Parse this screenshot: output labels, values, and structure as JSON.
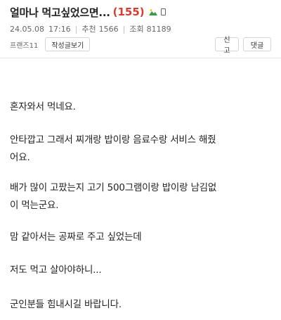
{
  "post": {
    "title": "얼마나 먹고싶었으면...",
    "comment_count": "(155)",
    "has_image_icon": "image-icon",
    "has_mobile_icon": "mobile-icon",
    "date": "24.05.08",
    "time": "17:16",
    "recommend_label": "추천",
    "recommend_count": "1566",
    "views_label": "조회",
    "views_count": "81189",
    "author": "프랜즈11",
    "author_posts_button": "작성글보기",
    "report_button": "신고",
    "reply_button": "댓글",
    "comment_count_color": "#d63b2f"
  },
  "body": {
    "paragraphs": [
      "혼자와서 먹네요.",
      "안타깝고 그래서 찌개랑 밥이랑 음료수랑 서비스 해줬\n어요.",
      "배가 많이 고팠는지 고기 500그램이랑 밥이랑 남김없\n이 먹는군요.",
      "맘 같아서는 공짜로 주고 싶었는데",
      "저도 먹고 살아야하니...",
      "군인분들 힘내시길 바랍니다."
    ]
  }
}
